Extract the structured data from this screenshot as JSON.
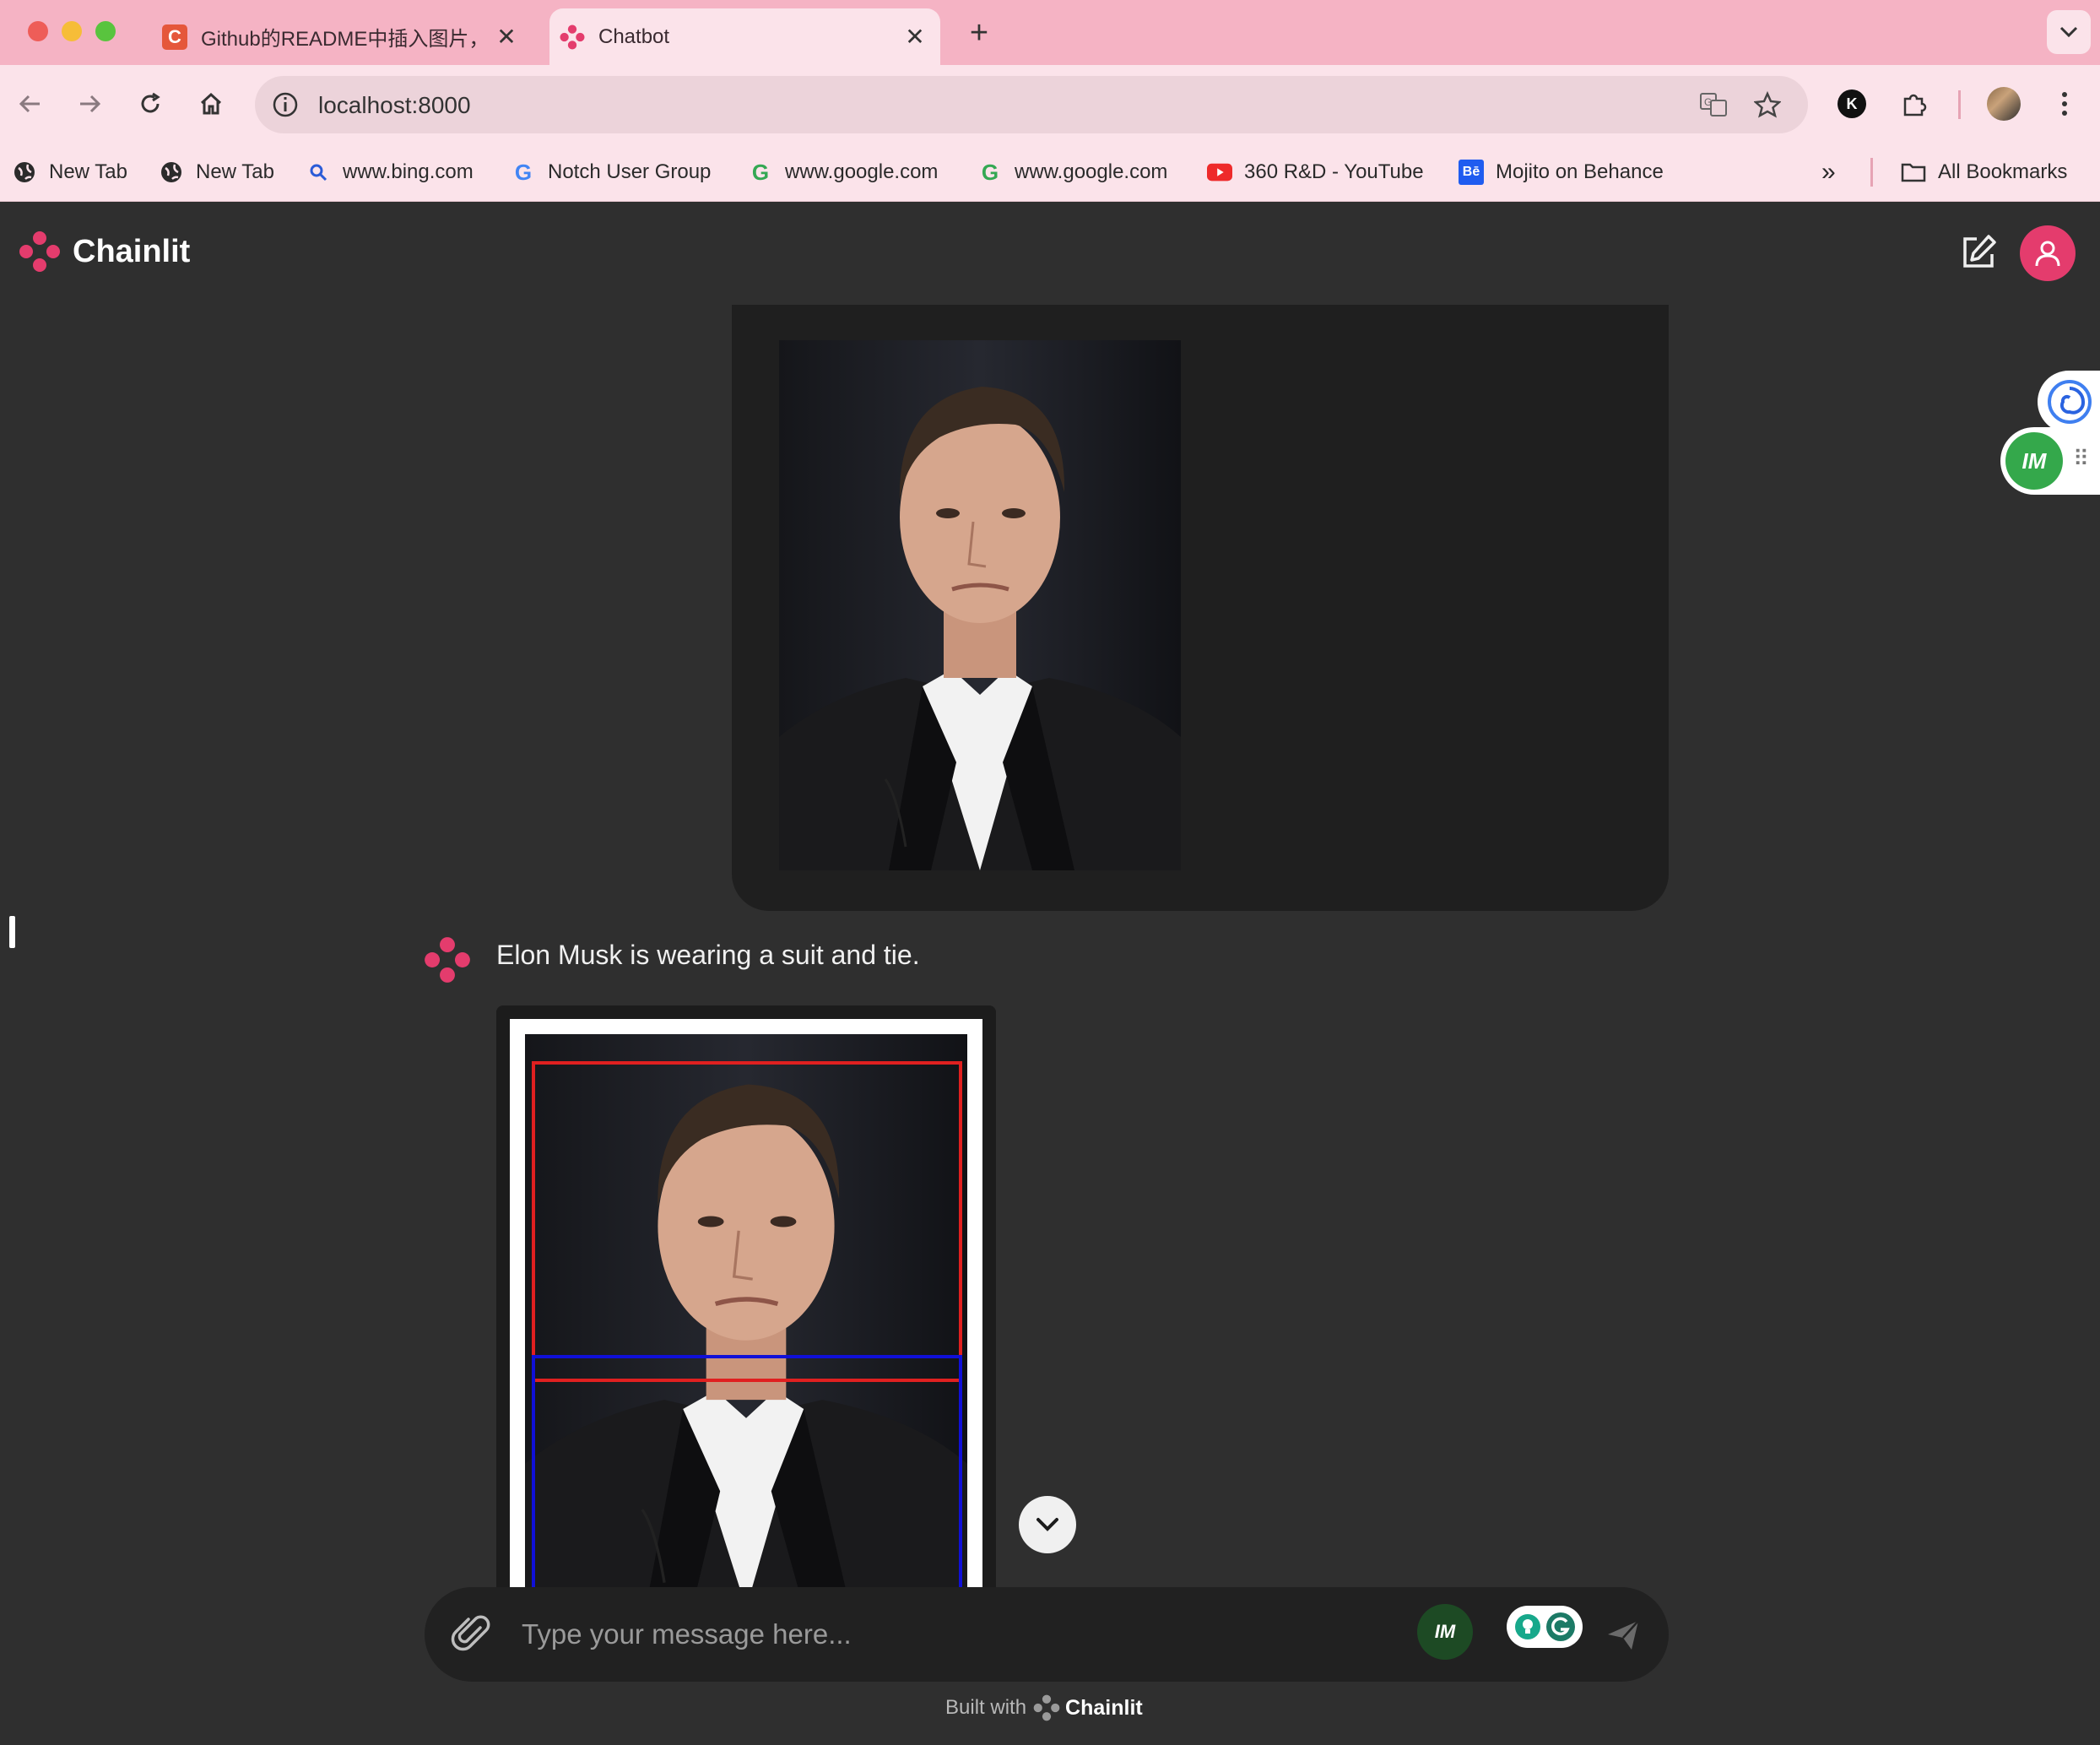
{
  "browser": {
    "tabs": [
      {
        "title": "Github的README中插入图片，",
        "active": false
      },
      {
        "title": "Chatbot",
        "active": true
      }
    ],
    "address": "localhost:8000",
    "bookmarks": [
      {
        "label": "New Tab",
        "icon": "globe-icon"
      },
      {
        "label": "New Tab",
        "icon": "globe-icon"
      },
      {
        "label": "www.bing.com",
        "icon": "search-icon"
      },
      {
        "label": "Notch User Group",
        "icon": "google-icon"
      },
      {
        "label": "www.google.com",
        "icon": "google-icon"
      },
      {
        "label": "www.google.com",
        "icon": "google-icon"
      },
      {
        "label": "360 R&D - YouTube",
        "icon": "youtube-icon"
      },
      {
        "label": "Mojito on Behance",
        "icon": "behance-icon"
      }
    ],
    "all_bookmarks": "All Bookmarks",
    "colors": {
      "tabbar": "#f5b3c4",
      "toolbar": "#fbe3ea"
    }
  },
  "app": {
    "name": "Chainlit",
    "bot_message": "Elon Musk is wearing a suit and tie.",
    "input_placeholder": "Type your message here...",
    "footer_prefix": "Built with",
    "footer_brand": "Chainlit",
    "side_badge": "IM",
    "composer_badge": "IM",
    "colors": {
      "accent": "#e43c6d",
      "background": "#2f2f2f",
      "face_box": "#e02020",
      "body_box": "#1010d8"
    }
  }
}
